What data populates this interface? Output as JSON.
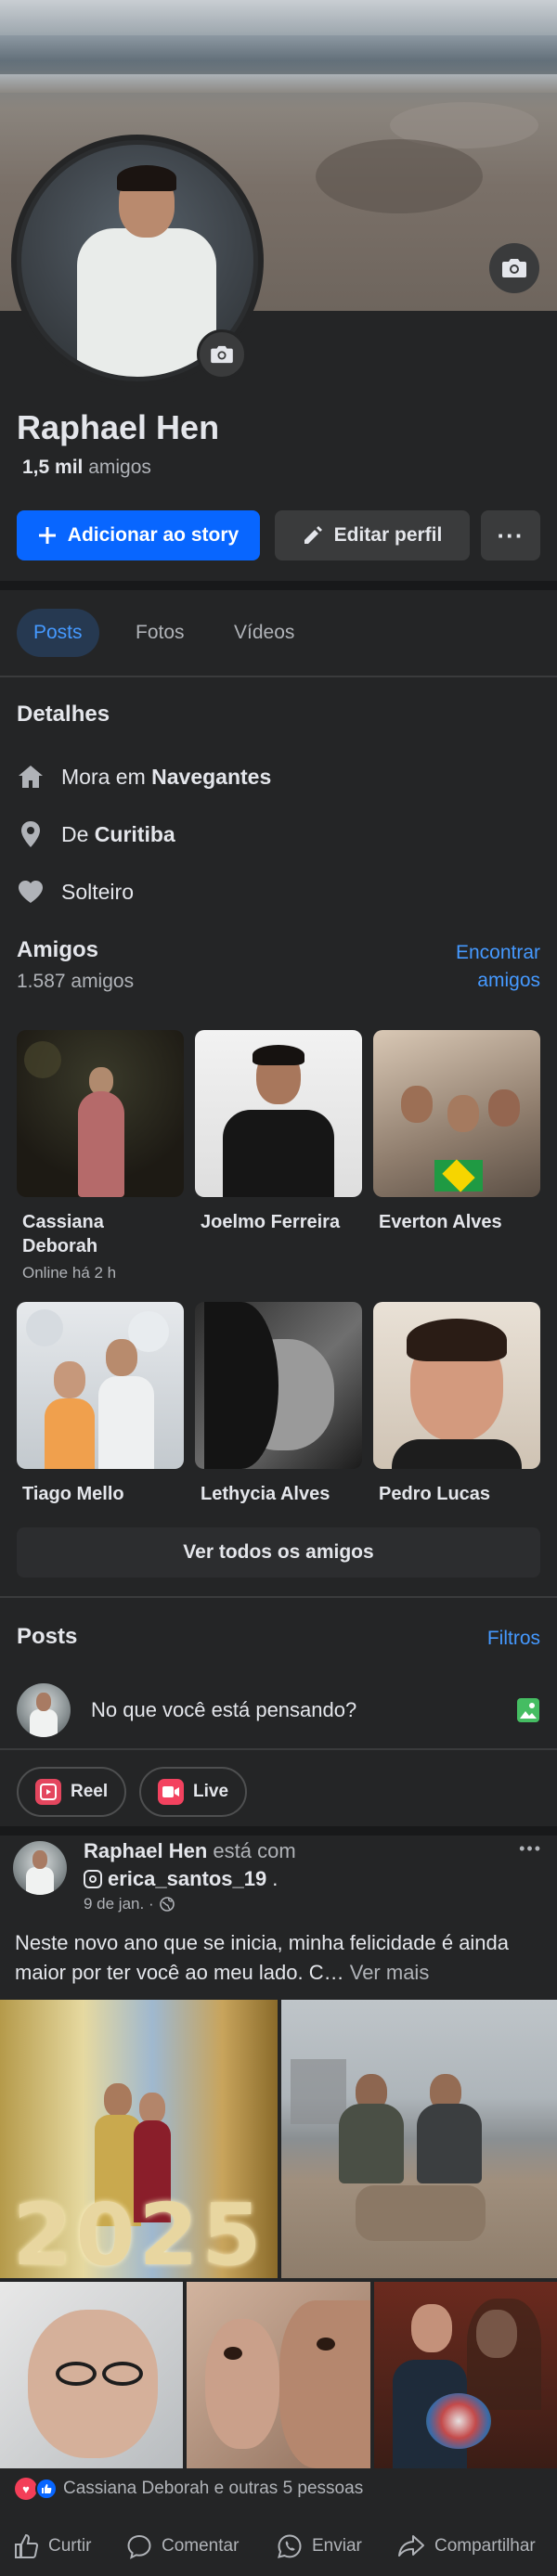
{
  "profile": {
    "name": "Raphael Hen",
    "friends_count": "1,5 mil",
    "friends_word": "amigos"
  },
  "buttons": {
    "add_story": "Adicionar ao story",
    "edit_profile": "Editar perfil",
    "more": "···"
  },
  "tabs": [
    "Posts",
    "Fotos",
    "Vídeos"
  ],
  "details": {
    "title": "Detalhes",
    "lives_prefix": "Mora em ",
    "lives_city": "Navegantes",
    "from_prefix": "De ",
    "from_city": "Curitiba",
    "relationship": "Solteiro"
  },
  "friends": {
    "title": "Amigos",
    "count": "1.587 amigos",
    "find_link_line1": "Encontrar",
    "find_link_line2": "amigos",
    "list": [
      {
        "name": "Cassiana Deborah",
        "sub": "Online há 2 h"
      },
      {
        "name": "Joelmo Ferreira",
        "sub": ""
      },
      {
        "name": "Everton Alves",
        "sub": ""
      },
      {
        "name": "Tiago Mello",
        "sub": ""
      },
      {
        "name": "Lethycia Alves",
        "sub": ""
      },
      {
        "name": "Pedro Lucas",
        "sub": ""
      }
    ],
    "see_all": "Ver todos os amigos"
  },
  "posts_section": {
    "title": "Posts",
    "filters": "Filtros",
    "composer_placeholder": "No que você está pensando?",
    "reel": "Reel",
    "live": "Live"
  },
  "post": {
    "author": "Raphael Hen",
    "with_text": "está com",
    "tagged": "erica_santos_19",
    "date": "9 de jan. ·",
    "text": "Neste novo ano que se inicia, minha felicidade é ainda maior por ter você ao meu lado. C…",
    "see_more": "Ver mais",
    "more": "•••",
    "reactions_text": "Cassiana Deborah e outras 5 pessoas",
    "actions": [
      "Curtir",
      "Comentar",
      "Enviar",
      "Compartilhar"
    ],
    "photo_number": "2025"
  },
  "colors": {
    "accent": "#0866ff",
    "link": "#4599ff",
    "background": "#242526",
    "separator": "#18191a"
  }
}
